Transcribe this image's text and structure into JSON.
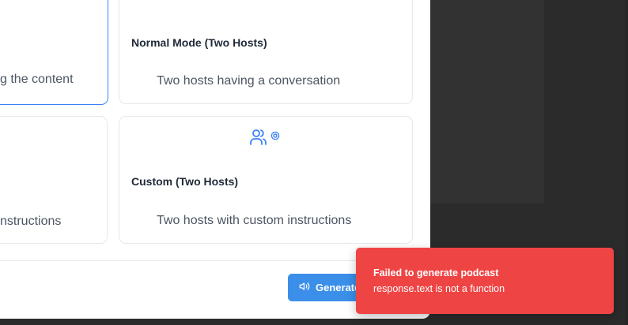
{
  "modes": [
    {
      "title": "",
      "description": "g the content",
      "selected": true,
      "icon": "users-icon"
    },
    {
      "title": "Normal Mode (Two Hosts)",
      "description": "Two hosts having a conversation",
      "selected": false,
      "icon": "users-icon"
    },
    {
      "title": "",
      "description": "nstructions",
      "selected": false,
      "icon": ""
    },
    {
      "title": "Custom (Two Hosts)",
      "description": "Two hosts with custom instructions",
      "selected": false,
      "icon": "users-gear-icon"
    }
  ],
  "footer": {
    "generate_label": "Generate Podcast",
    "generate_icon": "speaker-icon"
  },
  "toast": {
    "title": "Failed to generate podcast",
    "message": "response.text is not a function",
    "color": "#ef4444"
  },
  "colors": {
    "accent": "#3b82f6",
    "button": "#3b8fe8"
  }
}
